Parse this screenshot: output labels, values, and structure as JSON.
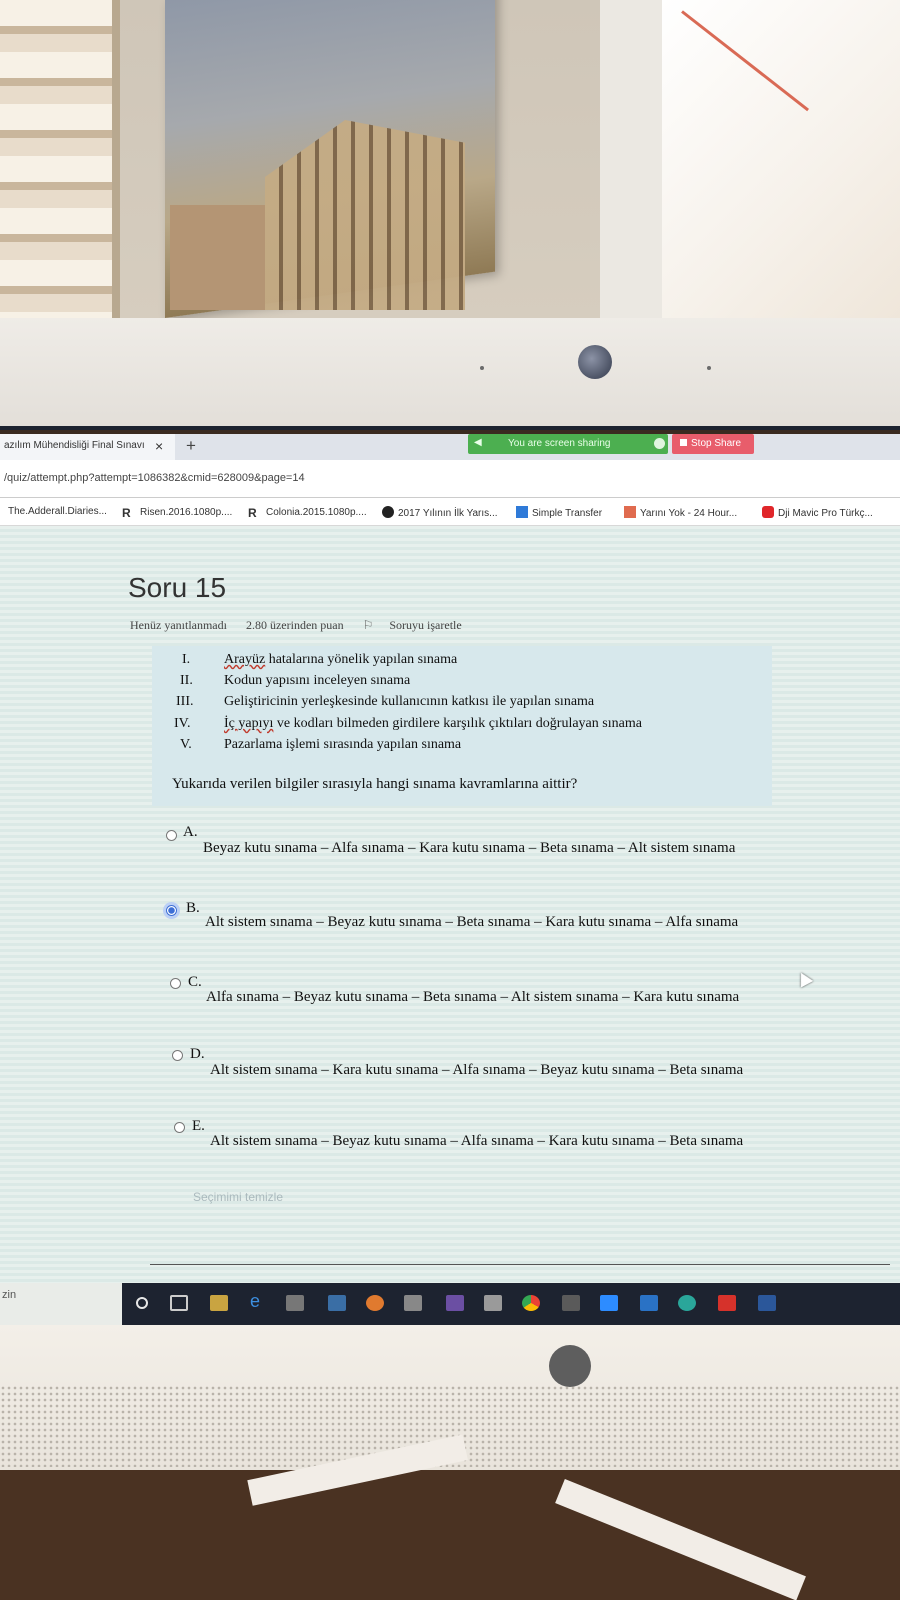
{
  "browser": {
    "tab_title": "azılım Mühendisliği Final Sınavı",
    "tab_close": "×",
    "new_tab": "+",
    "url": "/quiz/attempt.php?attempt=1086382&cmid=628009&page=14",
    "screen_share_text": "You are screen sharing",
    "stop_share_label": "Stop Share",
    "bookmarks": [
      {
        "label": "The.Adderall.Diaries...",
        "icon": "page-icon",
        "color": "#888888"
      },
      {
        "label": "Risen.2016.1080p....",
        "icon": "r-icon",
        "color": "#444444"
      },
      {
        "label": "Colonia.2015.1080p....",
        "icon": "r-icon",
        "color": "#444444"
      },
      {
        "label": "2017 Yılının İlk Yarıs...",
        "icon": "speech-icon",
        "color": "#222222"
      },
      {
        "label": "Simple Transfer",
        "icon": "transfer-icon",
        "color": "#2f7ad8"
      },
      {
        "label": "Yarını Yok - 24 Hour...",
        "icon": "bookmark-icon",
        "color": "#e06b4f"
      },
      {
        "label": "Dji Mavic Pro Türkç...",
        "icon": "youtube-icon",
        "color": "#e0262a"
      }
    ]
  },
  "question": {
    "title": "Soru 15",
    "status": "Henüz yanıtlanmadı",
    "points": "2.80 üzerinden puan",
    "flag_label": "Soruyu işaretle",
    "statements": [
      {
        "roman": "I.",
        "text": "Arayüz hatalarına yönelik yapılan sınama"
      },
      {
        "roman": "II.",
        "text": "Kodun yapısını inceleyen sınama"
      },
      {
        "roman": "III.",
        "text": "Geliştiricinin yerleşkesinde kullanıcının katkısı ile yapılan sınama"
      },
      {
        "roman": "IV.",
        "text": "İç yapıyı ve kodları bilmeden girdilere karşılık çıktıları doğrulayan sınama"
      },
      {
        "roman": "V.",
        "text": "Pazarlama işlemi sırasında yapılan sınama"
      }
    ],
    "prompt": "Yukarıda verilen bilgiler sırasıyla hangi sınama kavramlarına aittir?",
    "options": [
      {
        "letter": "A.",
        "text": "Beyaz kutu sınama – Alfa sınama – Kara kutu sınama – Beta sınama – Alt sistem sınama",
        "selected": false
      },
      {
        "letter": "B.",
        "text": "Alt sistem sınama – Beyaz kutu sınama – Beta sınama – Kara kutu sınama – Alfa sınama",
        "selected": true
      },
      {
        "letter": "C.",
        "text": "Alfa sınama – Beyaz kutu sınama – Beta sınama – Alt sistem sınama – Kara kutu sınama",
        "selected": false
      },
      {
        "letter": "D.",
        "text": "Alt sistem sınama – Kara kutu sınama – Alfa sınama – Beyaz kutu sınama – Beta sınama",
        "selected": false
      },
      {
        "letter": "E.",
        "text": "Alt sistem sınama – Beyaz kutu sınama – Alfa sınama – Kara kutu sınama – Beta sınama",
        "selected": false
      }
    ],
    "clear_choice": "Seçimimi temizle"
  },
  "taskbar": {
    "search_text": "zin",
    "apps": [
      "task-view-icon",
      "edge-icon",
      "keyboard-icon",
      "calculator-icon",
      "paint-icon",
      "store-icon",
      "vs-icon",
      "media-icon",
      "chrome-icon",
      "excel-icon",
      "zoom-icon",
      "outlook-icon",
      "edge-new-icon",
      "acrobat-icon",
      "word-icon"
    ]
  },
  "monitor": {
    "brand": "hp"
  }
}
